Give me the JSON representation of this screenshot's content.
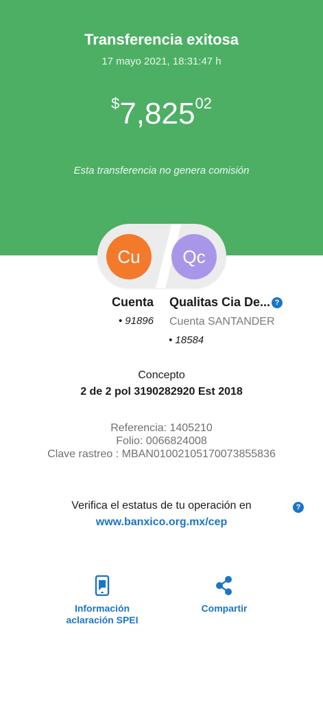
{
  "header": {
    "title": "Transferencia exitosa",
    "datetime": "17 mayo 2021, 18:31:47 h",
    "amount": {
      "currency": "$",
      "integer": "7,825",
      "decimals": "02"
    },
    "fee_note": "Esta transferencia no genera comisión",
    "background_color": "#4caf64"
  },
  "transfer": {
    "from": {
      "initials": "Cu",
      "name": "Cuenta",
      "account": "• 91896",
      "avatar_color": "#f37a2b"
    },
    "to": {
      "initials": "Qc",
      "name": "Qualitas Cia De...",
      "bank": "Cuenta SANTANDER",
      "account": "• 18584",
      "avatar_color": "#a996e9",
      "help_icon": "question-circle-icon"
    }
  },
  "concept": {
    "label": "Concepto",
    "value": "2 de 2 pol 3190282920 Est 2018"
  },
  "details": {
    "referencia": "Referencia: 1405210",
    "folio": "Folio: 0066824008",
    "clave_rastreo": "Clave rastreo : MBAN01002105170073855836"
  },
  "verification": {
    "text": "Verifica el estatus de tu operación en",
    "link": "www.banxico.org.mx/cep",
    "help_icon": "question-circle-icon"
  },
  "actions": {
    "spei": {
      "line1": "Información",
      "line2": "aclaración SPEI",
      "icon": "phone-document-icon"
    },
    "share": {
      "label": "Compartir",
      "icon": "share-icon"
    }
  },
  "help_glyph": "?",
  "accent_color": "#1b74c7"
}
